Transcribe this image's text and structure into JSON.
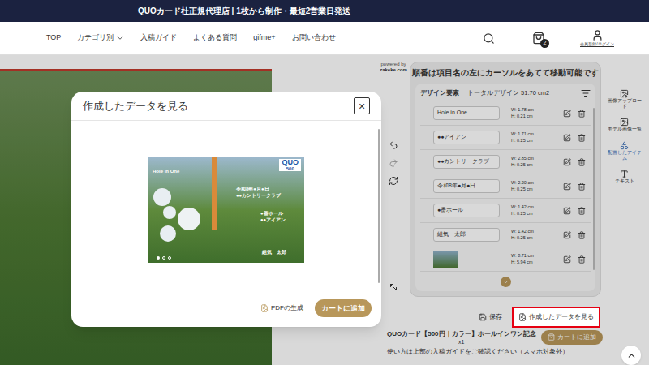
{
  "top_bar": {
    "text": "QUOカード杜正規代理店 | 1枚から制作・最短2営業日発送"
  },
  "nav": [
    {
      "label": "TOP",
      "has_menu": false
    },
    {
      "label": "カテゴリ別",
      "has_menu": true
    },
    {
      "label": "入稿ガイド",
      "has_menu": false
    },
    {
      "label": "よくある質問",
      "has_menu": false
    },
    {
      "label": "gifme+",
      "has_menu": false
    },
    {
      "label": "お問い合わせ",
      "has_menu": false
    }
  ],
  "header": {
    "cart_count": "2",
    "account_label": "会員登録/ログイン"
  },
  "editor": {
    "powered_by": "powered by",
    "powered_brand": "zakeke.com",
    "panel_title": "順番は項目名の左にカーソルをあてて移動可能です",
    "elements_label": "デザイン要素",
    "total_label": "トータルデザイン 51.70 cm2",
    "elements": [
      {
        "kind": "text",
        "name": "Hole in One",
        "w": "W: 1.78 cm",
        "h": "H: 0.21 cm"
      },
      {
        "kind": "text",
        "name": "●●アイアン",
        "w": "W: 1.71 cm",
        "h": "H: 0.25 cm"
      },
      {
        "kind": "text",
        "name": "●●カントリークラブ",
        "w": "W: 2.85 cm",
        "h": "H: 0.25 cm"
      },
      {
        "kind": "text",
        "name": "令和8年●月●日",
        "w": "W: 2.20 cm",
        "h": "H: 0.25 cm"
      },
      {
        "kind": "text",
        "name": "●番ホール",
        "w": "W: 1.42 cm",
        "h": "H: 0.25 cm"
      },
      {
        "kind": "text",
        "name": "組気　太郎",
        "w": "W: 1.42 cm",
        "h": "H: 0.25 cm"
      },
      {
        "kind": "image",
        "name": "",
        "w": "W: 8.71 cm",
        "h": "H: 5.94 cm"
      }
    ],
    "save": "保存",
    "view_data": "作成したデータを見る",
    "product": "QUOカード【500円｜カラー】ホールインワン記念",
    "qty": "x1",
    "note": "使い方は上部の入稿ガイドをご確認ください（スマホ対象外）",
    "cart": "カートに追加"
  },
  "sidebar": [
    {
      "label": "画像アップロード",
      "selected": false
    },
    {
      "label": "モデル画像一覧",
      "selected": false
    },
    {
      "label": "配置したアイテム",
      "selected": true
    },
    {
      "label": "テキスト",
      "selected": false
    }
  ],
  "modal": {
    "title": "作成したデータを見る",
    "close": "×",
    "preview": {
      "title": "Hole in One",
      "brand": "QUO",
      "value": "500",
      "lines": [
        "令和8年●月●日",
        "●●カントリークラブ"
      ],
      "lines2": [
        "●番ホール",
        "●●アイアン"
      ],
      "name": "組気　太郎"
    },
    "pages": [
      {
        "selected": true
      },
      {
        "selected": false
      },
      {
        "selected": false
      }
    ],
    "pdf": "PDFの生成",
    "cart": "カートに追加"
  }
}
